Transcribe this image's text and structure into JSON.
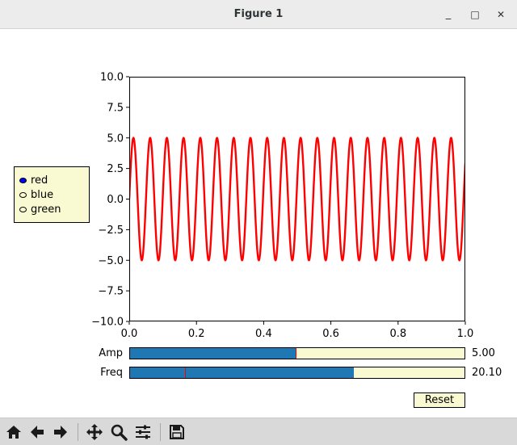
{
  "window": {
    "title": "Figure 1",
    "minimize_glyph": "_",
    "maximize_glyph": "□",
    "close_glyph": "✕"
  },
  "radio": {
    "selected_index": 0,
    "options": [
      "red",
      "blue",
      "green"
    ]
  },
  "sliders": [
    {
      "name": "amp",
      "label": "Amp",
      "value_text": "5.00",
      "value": 5.0,
      "min": 0.1,
      "max": 10.0,
      "initial": 5.0
    },
    {
      "name": "freq",
      "label": "Freq",
      "value_text": "20.10",
      "value": 20.1,
      "min": 0.1,
      "max": 30.0,
      "initial": 5.0
    }
  ],
  "reset_label": "Reset",
  "toolbar": {
    "buttons": [
      "home-icon",
      "back-icon",
      "forward-icon",
      "pan-icon",
      "zoom-icon",
      "configure-subplots-icon",
      "save-icon"
    ]
  },
  "colors": {
    "line": "#ff0000",
    "slider_fill": "#1f77b4",
    "widget_bg": "#fafad2",
    "radio_active": "#0000ff"
  },
  "chart_data": {
    "type": "line",
    "title": "",
    "xlabel": "",
    "ylabel": "",
    "xlim": [
      0.0,
      1.0
    ],
    "ylim": [
      -10.0,
      10.0
    ],
    "x_ticks": [
      "0.0",
      "0.2",
      "0.4",
      "0.6",
      "0.8",
      "1.0"
    ],
    "y_ticks": [
      "−10.0",
      "−7.5",
      "−5.0",
      "−2.5",
      "0.0",
      "2.5",
      "5.0",
      "7.5",
      "10.0"
    ],
    "grid": false,
    "series": [
      {
        "function": "sine",
        "amplitude": 5.0,
        "frequency": 20.1,
        "color": "#ff0000"
      }
    ]
  }
}
